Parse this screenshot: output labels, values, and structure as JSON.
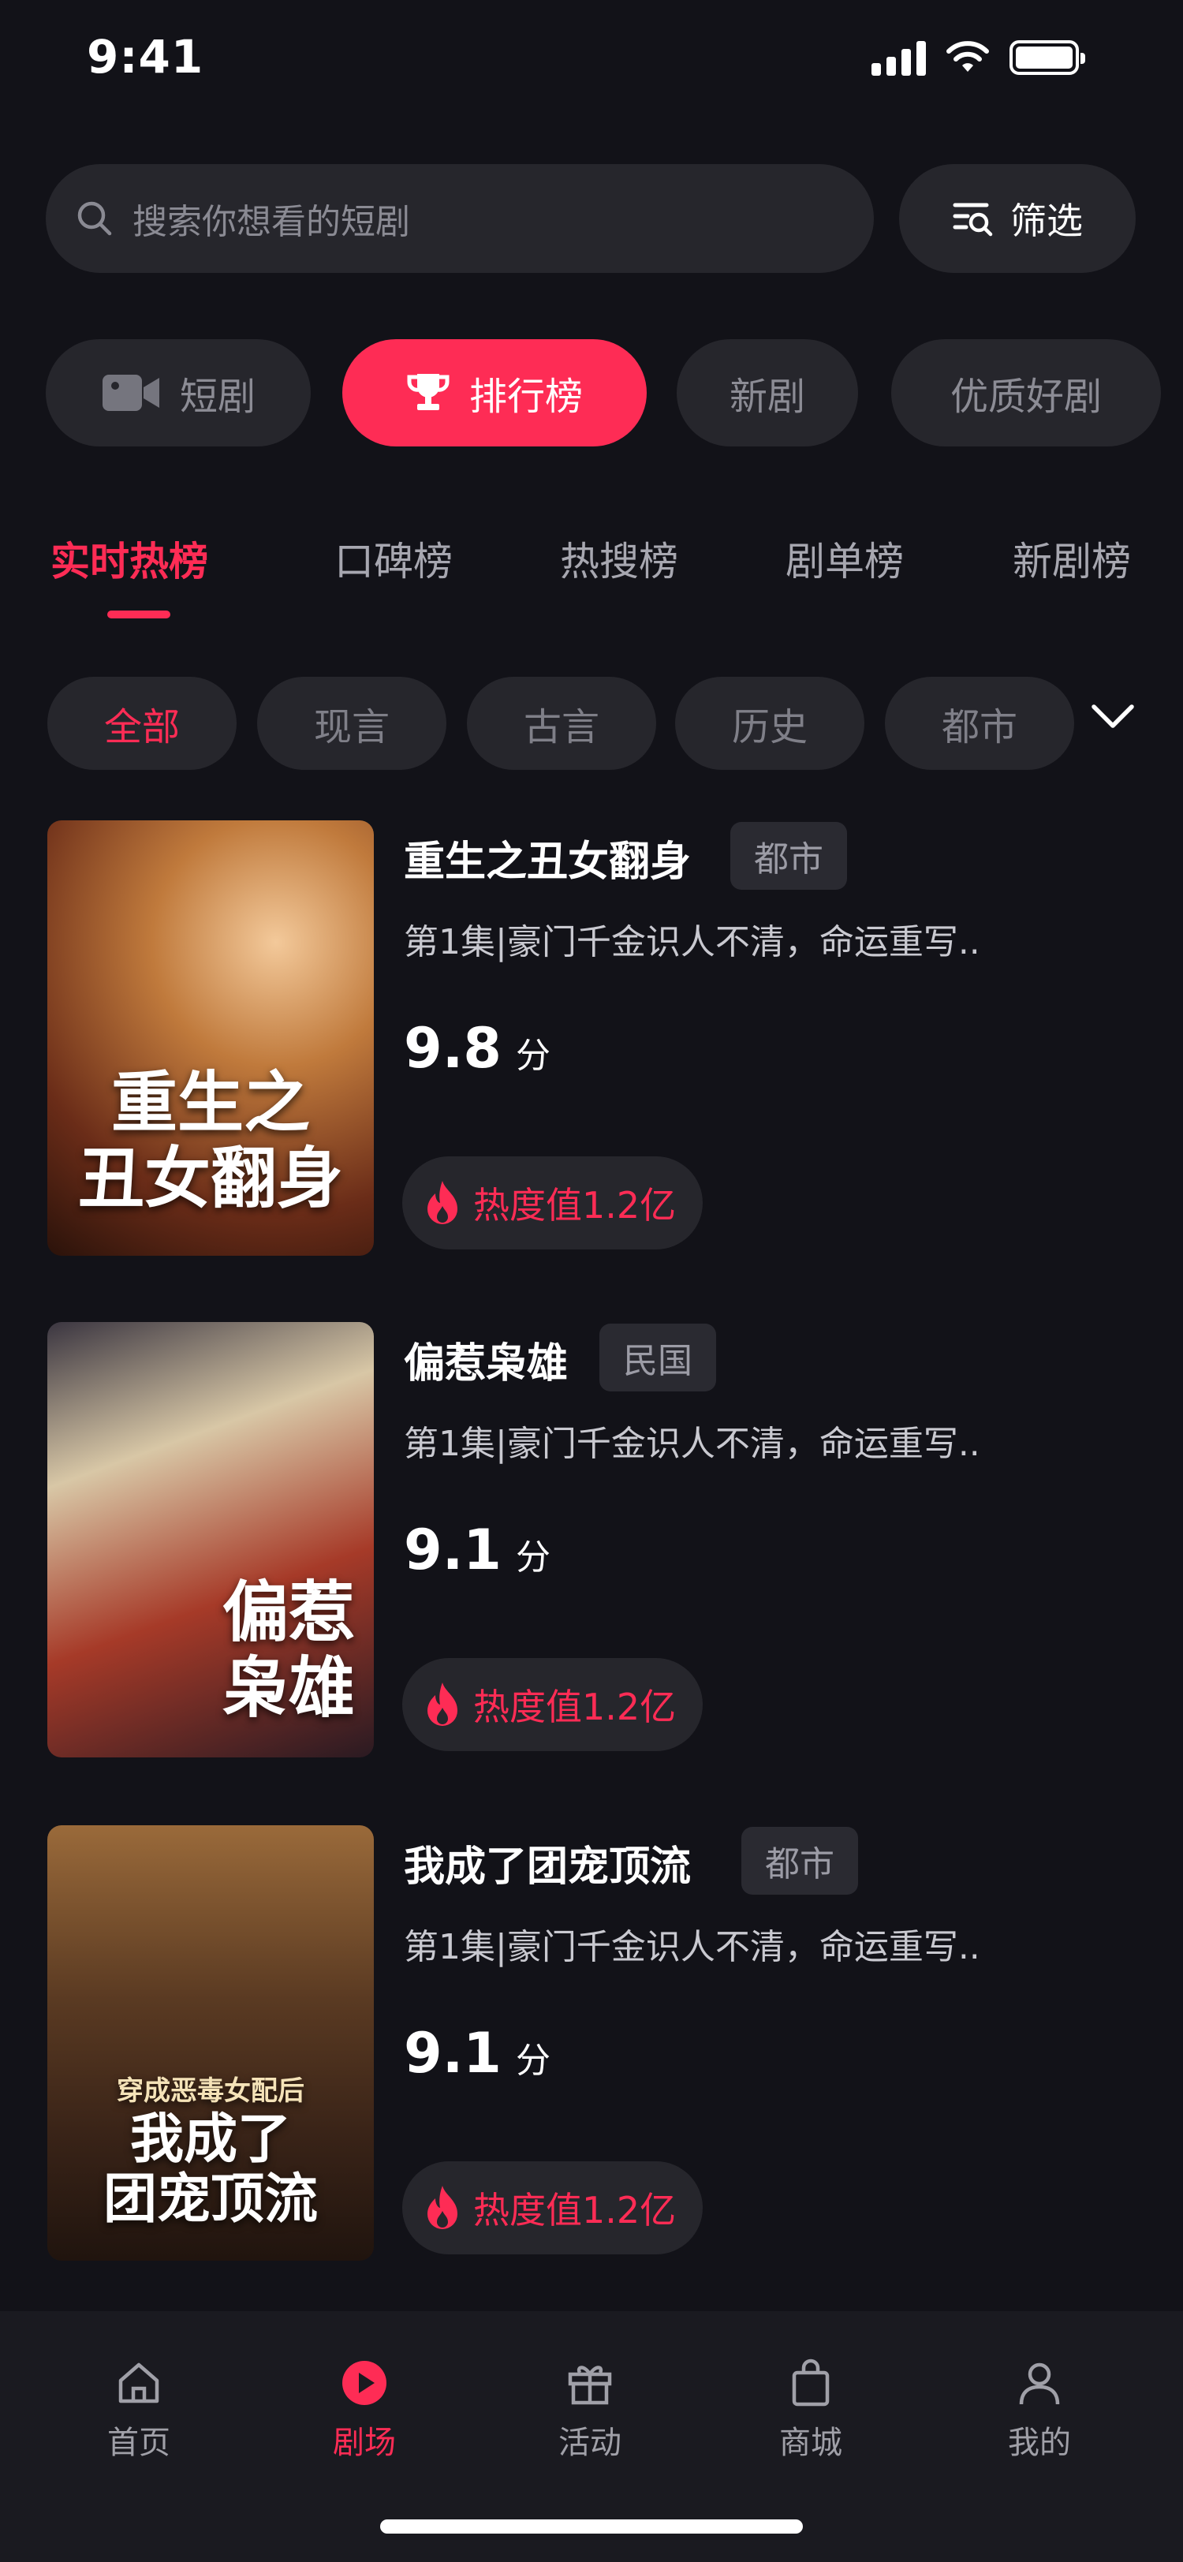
{
  "status_bar": {
    "time": "9:41"
  },
  "search": {
    "placeholder": "搜索你想看的短剧"
  },
  "filter": {
    "label": "筛选"
  },
  "category_pills": [
    {
      "label": "短剧",
      "icon": "video-camera-icon",
      "active": false
    },
    {
      "label": "排行榜",
      "icon": "trophy-icon",
      "active": true
    },
    {
      "label": "新剧",
      "active": false
    },
    {
      "label": "优质好剧",
      "active": false
    }
  ],
  "ranking_tabs": [
    {
      "label": "实时热榜",
      "active": true
    },
    {
      "label": "口碑榜",
      "active": false
    },
    {
      "label": "热搜榜",
      "active": false
    },
    {
      "label": "剧单榜",
      "active": false
    },
    {
      "label": "新剧榜",
      "active": false
    }
  ],
  "genre_chips": [
    {
      "label": "全部",
      "active": true
    },
    {
      "label": "现言",
      "active": false
    },
    {
      "label": "古言",
      "active": false
    },
    {
      "label": "历史",
      "active": false
    },
    {
      "label": "都市",
      "active": false
    }
  ],
  "dramas": [
    {
      "title": "重生之丑女翻身",
      "tag": "都市",
      "desc": "第1集|豪门千金识人不清，命运重写..",
      "score": "9.8",
      "score_unit": "分",
      "heat": "热度值1.2亿",
      "poster_text": [
        "重生之",
        "丑女翻身"
      ],
      "poster_colors": [
        "#c88a3e",
        "#5a2a18"
      ]
    },
    {
      "title": "偏惹枭雄",
      "tag": "民国",
      "desc": "第1集|豪门千金识人不清，命运重写..",
      "score": "9.1",
      "score_unit": "分",
      "heat": "热度值1.2亿",
      "poster_text": [
        "偏惹",
        "枭雄"
      ],
      "poster_colors": [
        "#e8d8b8",
        "#3a2a2a"
      ]
    },
    {
      "title": "我成了团宠顶流",
      "tag": "都市",
      "desc": "第1集|豪门千金识人不清，命运重写..",
      "score": "9.1",
      "score_unit": "分",
      "heat": "热度值1.2亿",
      "poster_text": [
        "穿成恶毒女配后",
        "我成了",
        "团宠顶流"
      ],
      "poster_colors": [
        "#b07840",
        "#2a1810"
      ]
    }
  ],
  "bottom_nav": [
    {
      "label": "首页",
      "icon": "home-icon",
      "active": false
    },
    {
      "label": "剧场",
      "icon": "play-circle-icon",
      "active": true
    },
    {
      "label": "活动",
      "icon": "gift-icon",
      "active": false
    },
    {
      "label": "商城",
      "icon": "shopping-bag-icon",
      "active": false
    },
    {
      "label": "我的",
      "icon": "user-icon",
      "active": false
    }
  ],
  "colors": {
    "accent": "#fe2c55",
    "background": "#121218",
    "surface": "#26262c"
  }
}
